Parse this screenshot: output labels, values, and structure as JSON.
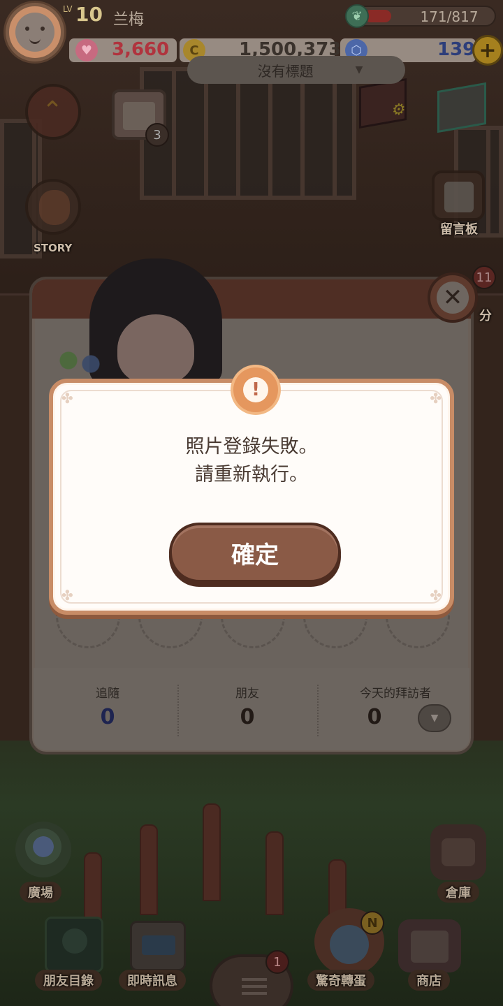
{
  "hud": {
    "level_prefix": "LV",
    "level": "10",
    "username": "兰梅",
    "energy_text": "171/817",
    "energy_fraction": 0.21,
    "hearts": "3,660",
    "coins": "1,500,373",
    "gems": "139",
    "add_label": "+"
  },
  "side": {
    "calendar_badge": "3",
    "story_label": "STORY",
    "guestbook_label": "留言板",
    "right_badge": "11",
    "right_partial_label": "分"
  },
  "profile_dialog": {
    "title_placeholder": "沒有標題",
    "stats": [
      {
        "label": "追隨",
        "value": "0"
      },
      {
        "label": "朋友",
        "value": "0"
      },
      {
        "label": "今天的拜訪者",
        "value": "0"
      }
    ]
  },
  "bottom_nav": {
    "plaza": "廣場",
    "storage": "倉庫",
    "friends_list": "朋友目錄",
    "instant_message": "即時訊息",
    "gacha": "驚奇轉蛋",
    "shop": "商店",
    "menu_badge": "1",
    "gacha_badge": "N"
  },
  "alert": {
    "icon": "exclamation-icon",
    "message_line1": "照片登錄失敗。",
    "message_line2": "請重新執行。",
    "confirm_label": "確定"
  },
  "colors": {
    "modal_border": "#c88c66",
    "button": "#8a5a46",
    "text": "#4a3b33"
  }
}
